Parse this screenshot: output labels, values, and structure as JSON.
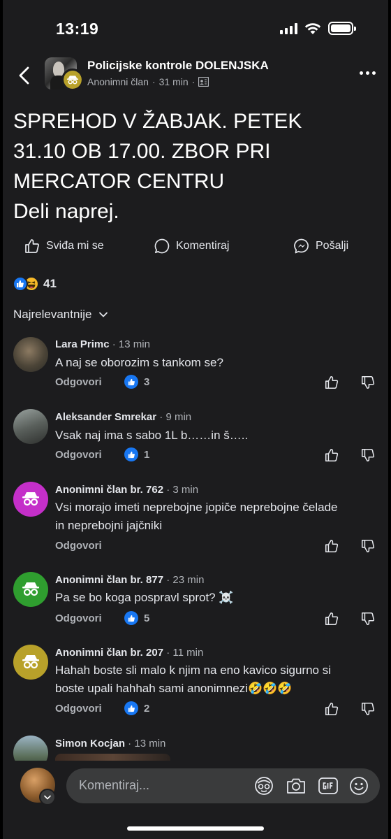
{
  "status_bar": {
    "time": "13:19"
  },
  "header": {
    "group_name": "Policijske kontrole DOLENJSKA",
    "author": "Anonimni član",
    "dot": "·",
    "time": "31 min"
  },
  "post": {
    "lines": [
      "SPREHOD V ŽABJAK. PETEK",
      "31.10 OB 17.00. ZBOR PRI",
      "MERCATOR CENTRU",
      "Deli naprej."
    ]
  },
  "actions": {
    "like": "Sviđa mi se",
    "comment": "Komentiraj",
    "send": "Pošalji"
  },
  "reactions": {
    "count": "41"
  },
  "sort": {
    "label": "Najrelevantnije"
  },
  "comments": [
    {
      "author": "Lara Primc",
      "time": "13 min",
      "text": "A naj se oborozim s tankom se?",
      "reply": "Odgovori",
      "likes": "3"
    },
    {
      "author": "Aleksander Smrekar",
      "time": "9 min",
      "text": "Vsak naj ima s sabo 1L b……in š…..",
      "reply": "Odgovori",
      "likes": "1"
    },
    {
      "author": "Anonimni član br. 762",
      "time": "3 min",
      "text_lines": [
        "Vsi morajo imeti neprebojne jopiče neprebojne čelade",
        "in neprebojni jajčniki"
      ],
      "reply": "Odgovori",
      "likes": "",
      "avatar_color": "#c42fc9"
    },
    {
      "author": "Anonimni član br. 877",
      "time": "23 min",
      "text": "Pa se bo koga pospravl sprot? ☠️",
      "reply": "Odgovori",
      "likes": "5",
      "avatar_color": "#2f9e2f"
    },
    {
      "author": "Anonimni član br. 207",
      "time": "11 min",
      "text_lines": [
        "Hahah boste sli malo k njim na eno kavico sigurno si",
        "boste upali hahhah sami anonimnezi🤣🤣🤣"
      ],
      "reply": "Odgovori",
      "likes": "2",
      "avatar_color": "#b8a12a"
    },
    {
      "author": "Simon Kocjan",
      "time": "13 min"
    }
  ],
  "composer": {
    "placeholder": "Komentiraj..."
  },
  "colors": {
    "background": "#1c1c1e",
    "accent": "#1877f2",
    "anon_badge": "#b8a12a"
  }
}
